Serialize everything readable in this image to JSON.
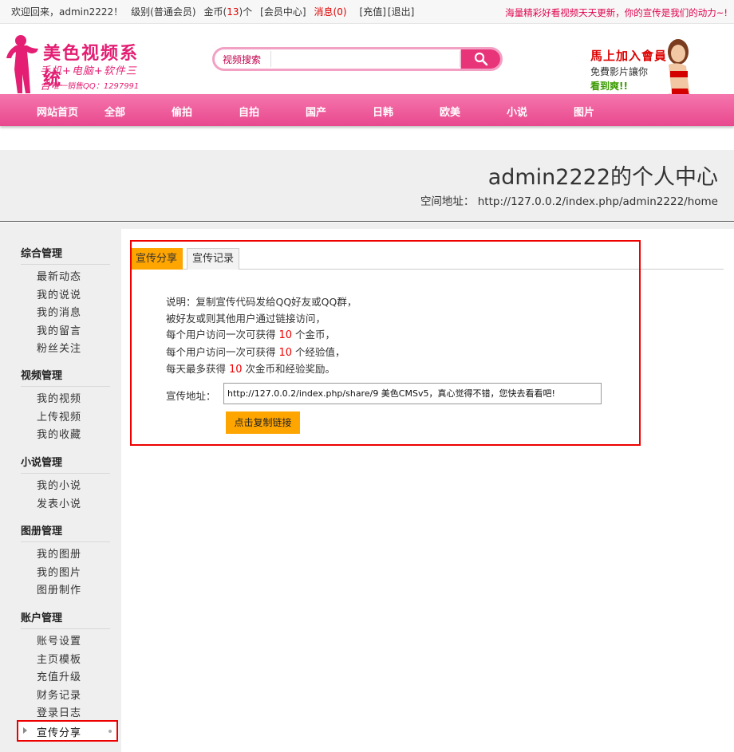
{
  "topbar": {
    "welcome": "欢迎回来，admin2222！",
    "level": "级别(普通会员)",
    "coins_prefix": "金币(",
    "coins_value": "13",
    "coins_suffix": ")个",
    "member_center": "[会员中心]",
    "messages": "消息(0)",
    "recharge": "[充值]",
    "logout": "[退出]",
    "slogan": "海量精彩好看视频天天更新，你的宣传是我们的动力~!"
  },
  "logo": {
    "title": "美色视频系统",
    "subtitle": "手机+电脑+软件三合一",
    "contact": "唯一销售QQ：1297991"
  },
  "search": {
    "label": "视频搜索",
    "placeholder": "",
    "button_icon": "search-icon"
  },
  "join": {
    "line1": "馬上加入會員",
    "line2": "免費影片讓你",
    "line3": "看到爽!!"
  },
  "nav": {
    "items": [
      "网站首页",
      "全部",
      "偷拍",
      "自拍",
      "国产",
      "日韩",
      "欧美",
      "小说",
      "图片"
    ]
  },
  "banner": {
    "title": "admin2222的个人中心",
    "address": "空间地址： http://127.0.0.2/index.php/admin2222/home"
  },
  "sidebar": {
    "groups": [
      {
        "title": "综合管理",
        "items": [
          "最新动态",
          "我的说说",
          "我的消息",
          "我的留言",
          "粉丝关注"
        ]
      },
      {
        "title": "视频管理",
        "items": [
          "我的视频",
          "上传视频",
          "我的收藏"
        ]
      },
      {
        "title": "小说管理",
        "items": [
          "我的小说",
          "发表小说"
        ]
      },
      {
        "title": "图册管理",
        "items": [
          "我的图册",
          "我的图片",
          "图册制作"
        ]
      },
      {
        "title": "账户管理",
        "items": [
          "账号设置",
          "主页模板",
          "充值升级",
          "财务记录",
          "登录日志"
        ]
      }
    ],
    "active_item": "宣传分享"
  },
  "content": {
    "tabs": [
      "宣传分享",
      "宣传记录"
    ],
    "desc": {
      "line1": "说明：复制宣传代码发给QQ好友或QQ群，",
      "line2": "被好友或则其他用户通过链接访问，",
      "line3_pre": "每个用户访问一次可获得 ",
      "line3_num": "10",
      "line3_post": " 个金币，",
      "line4_pre": "每个用户访问一次可获得 ",
      "line4_num": "10",
      "line4_post": " 个经验值，",
      "line5_pre": "每天最多获得 ",
      "line5_num": "10",
      "line5_post": " 次金币和经验奖励。"
    },
    "address_label": "宣传地址：",
    "address_value": "http://127.0.0.2/index.php/share/9   美色CMSv5，真心觉得不错，您快去看看吧!",
    "copy_button": "点击复制链接"
  },
  "colors": {
    "brand_pink": "#e8488e",
    "accent_orange": "#ffa500",
    "highlight_red": "#e00000"
  }
}
